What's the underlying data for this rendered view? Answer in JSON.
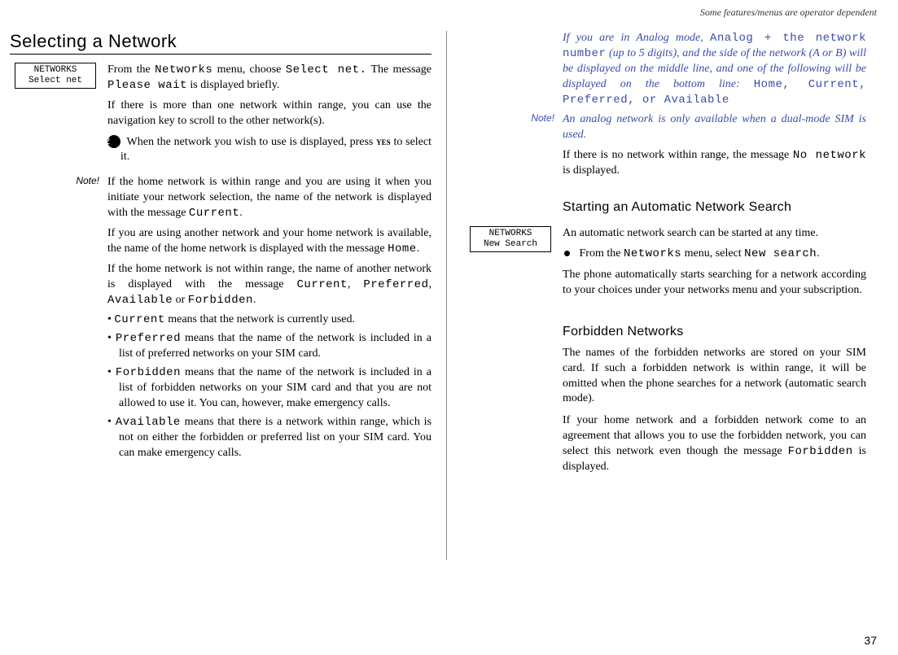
{
  "header": "Some features/menus are operator dependent",
  "left": {
    "title": "Selecting a Network",
    "box1_l1": "NETWORKS",
    "box1_l2": "Select net",
    "p1a": "From the ",
    "p1_mono1": "Networks",
    "p1b": " menu, choose ",
    "p1_mono2": "Select net.",
    "p1c": "  The message  ",
    "p1_mono3": "Please wait",
    "p1d": " is displayed briefly.",
    "p2": "If there is more than one network within range, you can use the navigation key to scroll to the other network(s).",
    "p3a": "When the network you wish to use is displayed, press ",
    "p3_yes": "yes",
    "p3b": " to select it.",
    "note_label": "Note!",
    "note1a": "If the home network is within range and you are using it when you initiate your network selection, the name of the network is displayed with the message ",
    "note1_mono": "Current",
    "note1b": ".",
    "p4a": "If you are using another network and your home network is available, the name of the home network is displayed with the message ",
    "p4_mono": "Home",
    "p4b": ".",
    "p5a": "If the home network is not within range, the name of another network is displayed with the message ",
    "p5_m1": "Current",
    "p5_c1": ", ",
    "p5_m2": "Preferred",
    "p5_c2": ", ",
    "p5_m3": "Available",
    "p5_c3": " or ",
    "p5_m4": "Forbidden",
    "p5b": ".",
    "li1_m": "Current",
    "li1_t": " means that the network is currently used.",
    "li2_m": "Preferred",
    "li2_t": " means that the name of the network is included in a list of preferred networks on your SIM card.",
    "li3_m": "Forbidden",
    "li3_t": " means that the name of the network is included in a list of forbidden networks on your SIM card and that you are not allowed to use it. You can, however, make emergency calls.",
    "li4_m": "Available",
    "li4_t": " means that there is a network within range, which is not on either the forbidden or preferred list on your SIM card. You can make emergency calls."
  },
  "right": {
    "analog_a": "If you are in Analog mode, ",
    "analog_m1": "Analog + the network number",
    "analog_b": " (up to 5 digits), and the side of the network (A or B) will be displayed on the middle line,  and one of the following will be displayed on the bottom line:  ",
    "analog_m2": "Home, Current, Preferred, or Available",
    "note_label": "Note!",
    "note2": "An analog network is only available when a dual-mode SIM is used.",
    "p_no_a": "If there is no network within range, the message ",
    "p_no_m": "No network",
    "p_no_b": " is displayed.",
    "sub1": "Starting an Automatic Network Search",
    "box2_l1": "NETWORKS",
    "box2_l2": "New Search",
    "auto1": "An automatic network search can be started at any time.",
    "auto2a": "From the ",
    "auto2_m1": "Networks",
    "auto2b": " menu, select ",
    "auto2_m2": "New search",
    "auto2c": ".",
    "auto3": "The phone  automatically starts searching for a network according to your choices under your networks menu and your subscription.",
    "sub2": "Forbidden Networks",
    "forb1": "The names of the forbidden networks are stored on your SIM card. If such a forbidden network is within range, it will be omitted when the phone searches for a network (automatic search mode).",
    "forb2a": "If your home network and a forbidden network come to an agreement that allows you to use the forbidden network, you can select this network even though the message ",
    "forb2_m": "Forbidden",
    "forb2b": " is displayed."
  },
  "page_number": "37"
}
